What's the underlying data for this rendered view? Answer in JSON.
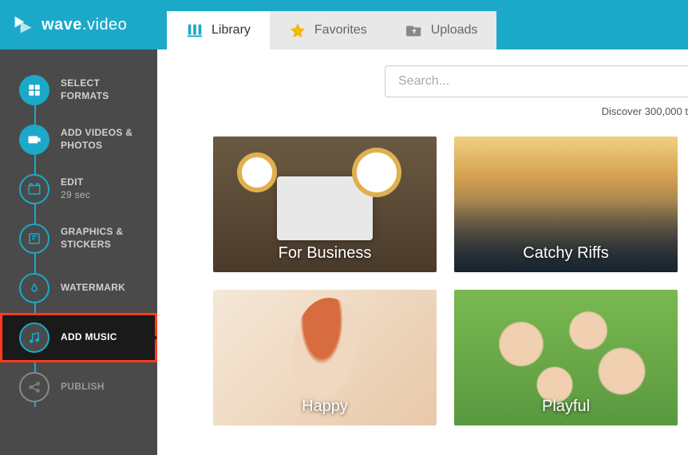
{
  "brand": {
    "name_part1": "wave",
    "name_part2": ".video"
  },
  "sidebar": {
    "steps": [
      {
        "label": "SELECT FORMATS",
        "sub": ""
      },
      {
        "label": "ADD VIDEOS & PHOTOS",
        "sub": ""
      },
      {
        "label": "EDIT",
        "sub": "29 sec"
      },
      {
        "label": "GRAPHICS & STICKERS",
        "sub": ""
      },
      {
        "label": "WATERMARK",
        "sub": ""
      },
      {
        "label": "ADD MUSIC",
        "sub": ""
      },
      {
        "label": "PUBLISH",
        "sub": ""
      }
    ]
  },
  "tabs": [
    {
      "label": "Library"
    },
    {
      "label": "Favorites"
    },
    {
      "label": "Uploads"
    }
  ],
  "search": {
    "placeholder": "Search...",
    "value": ""
  },
  "discover_text": "Discover 300,000 t",
  "cards": [
    {
      "label": "For Business"
    },
    {
      "label": "Catchy Riffs"
    },
    {
      "label": "Happy"
    },
    {
      "label": "Playful"
    }
  ]
}
